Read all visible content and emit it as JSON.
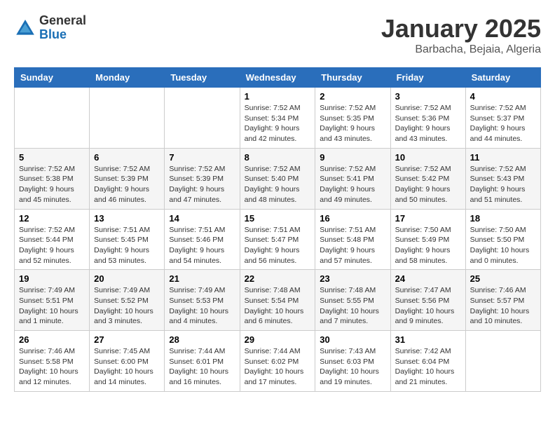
{
  "logo": {
    "general": "General",
    "blue": "Blue"
  },
  "header": {
    "month": "January 2025",
    "location": "Barbacha, Bejaia, Algeria"
  },
  "weekdays": [
    "Sunday",
    "Monday",
    "Tuesday",
    "Wednesday",
    "Thursday",
    "Friday",
    "Saturday"
  ],
  "weeks": [
    [
      null,
      null,
      null,
      {
        "day": 1,
        "sunrise": "7:52 AM",
        "sunset": "5:34 PM",
        "daylight": "9 hours and 42 minutes."
      },
      {
        "day": 2,
        "sunrise": "7:52 AM",
        "sunset": "5:35 PM",
        "daylight": "9 hours and 43 minutes."
      },
      {
        "day": 3,
        "sunrise": "7:52 AM",
        "sunset": "5:36 PM",
        "daylight": "9 hours and 43 minutes."
      },
      {
        "day": 4,
        "sunrise": "7:52 AM",
        "sunset": "5:37 PM",
        "daylight": "9 hours and 44 minutes."
      }
    ],
    [
      {
        "day": 5,
        "sunrise": "7:52 AM",
        "sunset": "5:38 PM",
        "daylight": "9 hours and 45 minutes."
      },
      {
        "day": 6,
        "sunrise": "7:52 AM",
        "sunset": "5:39 PM",
        "daylight": "9 hours and 46 minutes."
      },
      {
        "day": 7,
        "sunrise": "7:52 AM",
        "sunset": "5:39 PM",
        "daylight": "9 hours and 47 minutes."
      },
      {
        "day": 8,
        "sunrise": "7:52 AM",
        "sunset": "5:40 PM",
        "daylight": "9 hours and 48 minutes."
      },
      {
        "day": 9,
        "sunrise": "7:52 AM",
        "sunset": "5:41 PM",
        "daylight": "9 hours and 49 minutes."
      },
      {
        "day": 10,
        "sunrise": "7:52 AM",
        "sunset": "5:42 PM",
        "daylight": "9 hours and 50 minutes."
      },
      {
        "day": 11,
        "sunrise": "7:52 AM",
        "sunset": "5:43 PM",
        "daylight": "9 hours and 51 minutes."
      }
    ],
    [
      {
        "day": 12,
        "sunrise": "7:52 AM",
        "sunset": "5:44 PM",
        "daylight": "9 hours and 52 minutes."
      },
      {
        "day": 13,
        "sunrise": "7:51 AM",
        "sunset": "5:45 PM",
        "daylight": "9 hours and 53 minutes."
      },
      {
        "day": 14,
        "sunrise": "7:51 AM",
        "sunset": "5:46 PM",
        "daylight": "9 hours and 54 minutes."
      },
      {
        "day": 15,
        "sunrise": "7:51 AM",
        "sunset": "5:47 PM",
        "daylight": "9 hours and 56 minutes."
      },
      {
        "day": 16,
        "sunrise": "7:51 AM",
        "sunset": "5:48 PM",
        "daylight": "9 hours and 57 minutes."
      },
      {
        "day": 17,
        "sunrise": "7:50 AM",
        "sunset": "5:49 PM",
        "daylight": "9 hours and 58 minutes."
      },
      {
        "day": 18,
        "sunrise": "7:50 AM",
        "sunset": "5:50 PM",
        "daylight": "10 hours and 0 minutes."
      }
    ],
    [
      {
        "day": 19,
        "sunrise": "7:49 AM",
        "sunset": "5:51 PM",
        "daylight": "10 hours and 1 minute."
      },
      {
        "day": 20,
        "sunrise": "7:49 AM",
        "sunset": "5:52 PM",
        "daylight": "10 hours and 3 minutes."
      },
      {
        "day": 21,
        "sunrise": "7:49 AM",
        "sunset": "5:53 PM",
        "daylight": "10 hours and 4 minutes."
      },
      {
        "day": 22,
        "sunrise": "7:48 AM",
        "sunset": "5:54 PM",
        "daylight": "10 hours and 6 minutes."
      },
      {
        "day": 23,
        "sunrise": "7:48 AM",
        "sunset": "5:55 PM",
        "daylight": "10 hours and 7 minutes."
      },
      {
        "day": 24,
        "sunrise": "7:47 AM",
        "sunset": "5:56 PM",
        "daylight": "10 hours and 9 minutes."
      },
      {
        "day": 25,
        "sunrise": "7:46 AM",
        "sunset": "5:57 PM",
        "daylight": "10 hours and 10 minutes."
      }
    ],
    [
      {
        "day": 26,
        "sunrise": "7:46 AM",
        "sunset": "5:58 PM",
        "daylight": "10 hours and 12 minutes."
      },
      {
        "day": 27,
        "sunrise": "7:45 AM",
        "sunset": "6:00 PM",
        "daylight": "10 hours and 14 minutes."
      },
      {
        "day": 28,
        "sunrise": "7:44 AM",
        "sunset": "6:01 PM",
        "daylight": "10 hours and 16 minutes."
      },
      {
        "day": 29,
        "sunrise": "7:44 AM",
        "sunset": "6:02 PM",
        "daylight": "10 hours and 17 minutes."
      },
      {
        "day": 30,
        "sunrise": "7:43 AM",
        "sunset": "6:03 PM",
        "daylight": "10 hours and 19 minutes."
      },
      {
        "day": 31,
        "sunrise": "7:42 AM",
        "sunset": "6:04 PM",
        "daylight": "10 hours and 21 minutes."
      },
      null
    ]
  ],
  "labels": {
    "sunrise": "Sunrise:",
    "sunset": "Sunset:",
    "daylight": "Daylight:"
  }
}
